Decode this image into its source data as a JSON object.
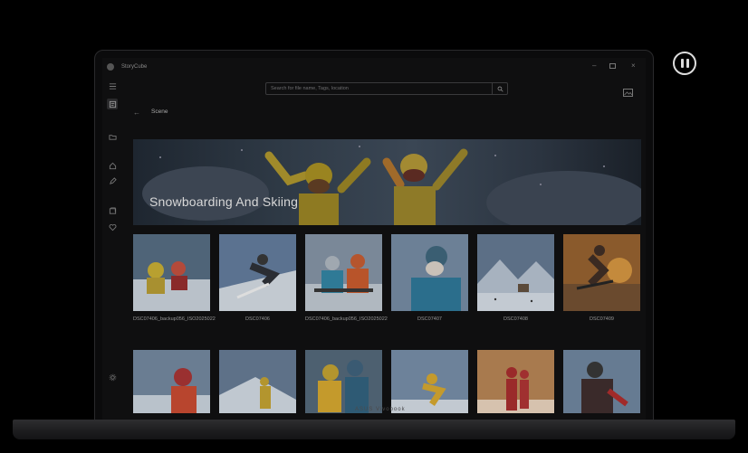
{
  "app": {
    "name": "StoryCube"
  },
  "search": {
    "placeholder": "Search for file name, Tags, location"
  },
  "page": {
    "title": "Scene"
  },
  "hero": {
    "title": "Snowboarding And Skiing"
  },
  "device": {
    "brand": "ASUS Vivobook"
  },
  "photos": [
    {
      "caption": "DSC07406_backup056_ISO2025022"
    },
    {
      "caption": "DSC07406"
    },
    {
      "caption": "DSC07406_backup056_ISO2025022"
    },
    {
      "caption": "DSC07407"
    },
    {
      "caption": "DSC07408"
    },
    {
      "caption": "DSC07409"
    }
  ],
  "icons": {
    "menu": "hamburger-icon",
    "photos": "photo-icon",
    "folder": "folder-icon",
    "home": "home-icon",
    "edit": "pencil-icon",
    "album": "album-icon",
    "favorite": "heart-icon",
    "settings": "gear-icon",
    "search": "search-icon",
    "view": "image-icon",
    "pause": "pause-icon"
  }
}
